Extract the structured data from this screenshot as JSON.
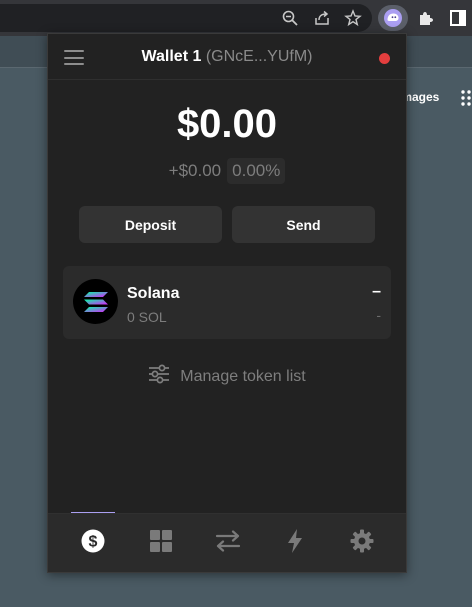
{
  "browser": {
    "images_link": "Images",
    "icons": [
      "zoom-out-icon",
      "share-icon",
      "star-icon",
      "extension-wallet-icon",
      "puzzle-icon",
      "sidebar-icon"
    ]
  },
  "wallet": {
    "name": "Wallet 1",
    "address": "(GNcE...YUfM)",
    "status_color": "#e33e3e",
    "balance": "$0.00",
    "change_value": "+$0.00",
    "change_percent": "0.00%",
    "deposit_label": "Deposit",
    "send_label": "Send",
    "tokens": [
      {
        "name": "Solana",
        "amount": "0 SOL",
        "value": "–",
        "change": "-"
      }
    ],
    "manage_label": "Manage token list",
    "tabs": [
      {
        "name": "tab-wallet",
        "icon": "dollar-icon",
        "active": true
      },
      {
        "name": "tab-collectibles",
        "icon": "grid-icon",
        "active": false
      },
      {
        "name": "tab-swap",
        "icon": "swap-arrows-icon",
        "active": false
      },
      {
        "name": "tab-activity",
        "icon": "lightning-icon",
        "active": false
      },
      {
        "name": "tab-settings",
        "icon": "gear-icon",
        "active": false
      }
    ],
    "accent_color": "#ab9ff2"
  }
}
